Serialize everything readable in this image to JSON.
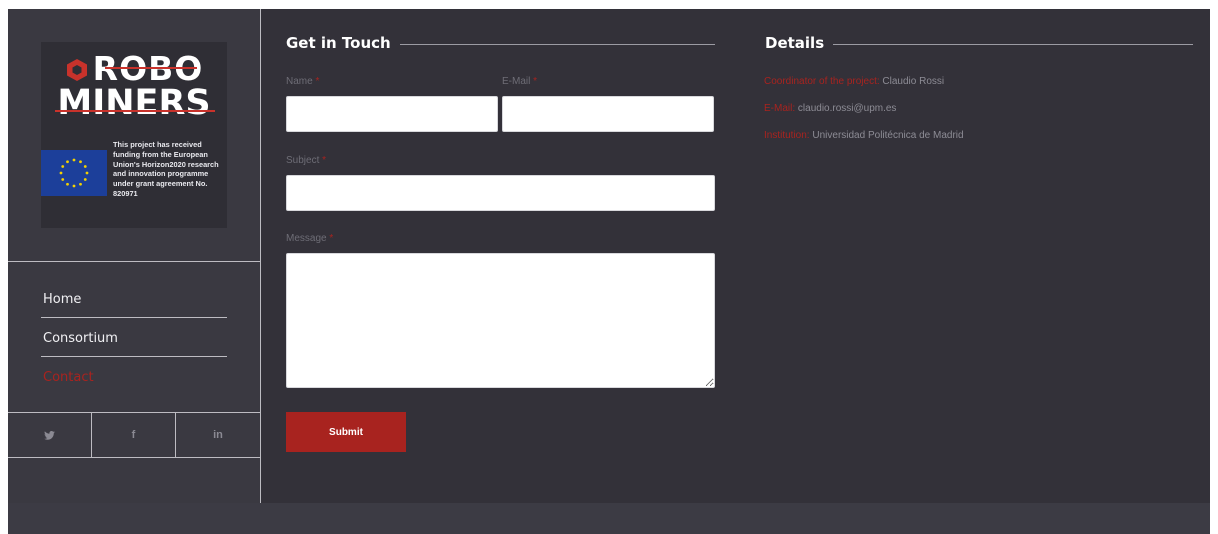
{
  "logo": {
    "line1": "ROBO",
    "line2": "MINERS",
    "icon": "hexagon-icon",
    "eu_flag_icon": "eu-flag-icon",
    "funding_text": "This project has received funding from the European Union's Horizon2020 research and innovation programme under grant agreement No. 820971"
  },
  "nav": {
    "items": [
      {
        "label": "Home",
        "active": false
      },
      {
        "label": "Consortium",
        "active": false
      },
      {
        "label": "Contact",
        "active": true
      }
    ]
  },
  "social": [
    {
      "icon": "twitter-icon",
      "glyph": "🐦"
    },
    {
      "icon": "facebook-icon",
      "glyph": "f"
    },
    {
      "icon": "linkedin-icon",
      "glyph": "in"
    }
  ],
  "form": {
    "title": "Get in Touch",
    "name_label": "Name",
    "email_label": "E-Mail",
    "subject_label": "Subject",
    "message_label": "Message",
    "required_mark": "*",
    "name_value": "",
    "email_value": "",
    "subject_value": "",
    "message_value": "",
    "submit_label": "Submit"
  },
  "details": {
    "title": "Details",
    "coordinator_key": "Coordinator of the project:",
    "coordinator_value": "Claudio Rossi",
    "email_key": "E-Mail:",
    "email_value": "claudio.rossi@upm.es",
    "institution_key": "Institution:",
    "institution_value": "Universidad Politécnica de Madrid"
  },
  "colors": {
    "accent": "#a8231f",
    "background": "#333139",
    "sidebar": "#3a3941"
  }
}
